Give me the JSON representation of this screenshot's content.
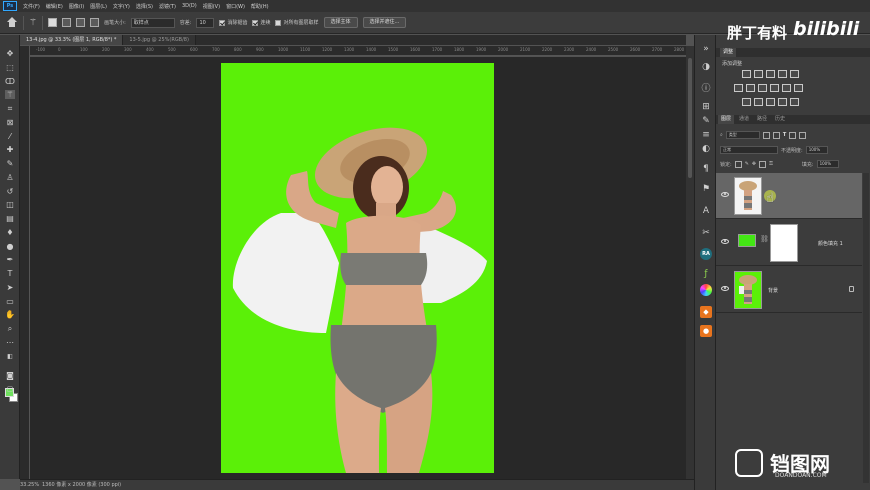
{
  "app": {
    "logo": "Ps",
    "menu": [
      "文件(F)",
      "编辑(E)",
      "图像(I)",
      "图层(L)",
      "文字(Y)",
      "选择(S)",
      "滤镜(T)",
      "3D(D)",
      "视图(V)",
      "窗口(W)",
      "帮助(H)"
    ]
  },
  "options": {
    "brush_size_label": "画笔大小:",
    "brush_size_value": "取样点",
    "tolerance_label": "容差:",
    "tolerance_value": "10",
    "antialias_label": "消除锯齿",
    "contiguous_label": "连续",
    "sample_all_label": "对所有图层取样",
    "select_subject_label": "选择主体",
    "select_mask_label": "选择并遮住..."
  },
  "tabs": [
    {
      "label": "13-4.jpg @ 33.3% (图层 1, RGB/8*) *",
      "active": true
    },
    {
      "label": "13-5.jpg @ 25%(RGB/8)",
      "active": false
    }
  ],
  "ruler": [
    "-100",
    "0",
    "100",
    "200",
    "300",
    "400",
    "500",
    "600",
    "700",
    "800",
    "900",
    "1000",
    "1100",
    "1200",
    "1300",
    "1400",
    "1500",
    "1600",
    "1700",
    "1800",
    "1900",
    "2000",
    "2100",
    "2200",
    "2300",
    "2400",
    "2500",
    "2600",
    "2700",
    "2800"
  ],
  "status": {
    "zoom": "33.25%",
    "doc_info": "1360 像素 x 2000 像素 (300 ppi)"
  },
  "canvas": {
    "background_color": "#5bf008",
    "accent_fg": "#6fe15e"
  },
  "panels": {
    "adjustments_tab": "调整",
    "adjustments_title": "添加调整",
    "layers_tabs": [
      "图层",
      "通道",
      "路径",
      "历史"
    ],
    "kind_label": "类型",
    "blend_mode": "正常",
    "opacity_label": "不透明度:",
    "opacity_value": "100%",
    "lock_label": "锁定:",
    "fill_label": "填充:",
    "fill_value": "100%"
  },
  "layers": [
    {
      "name": "",
      "selected": true
    },
    {
      "name": "颜色填充 1",
      "selected": false
    },
    {
      "name": "背景",
      "selected": false
    }
  ],
  "watermarks": {
    "channel": "胖丁有料",
    "site": "bilibili",
    "corner": "铛图网",
    "corner_sub": "DOANDOAN.COM"
  }
}
